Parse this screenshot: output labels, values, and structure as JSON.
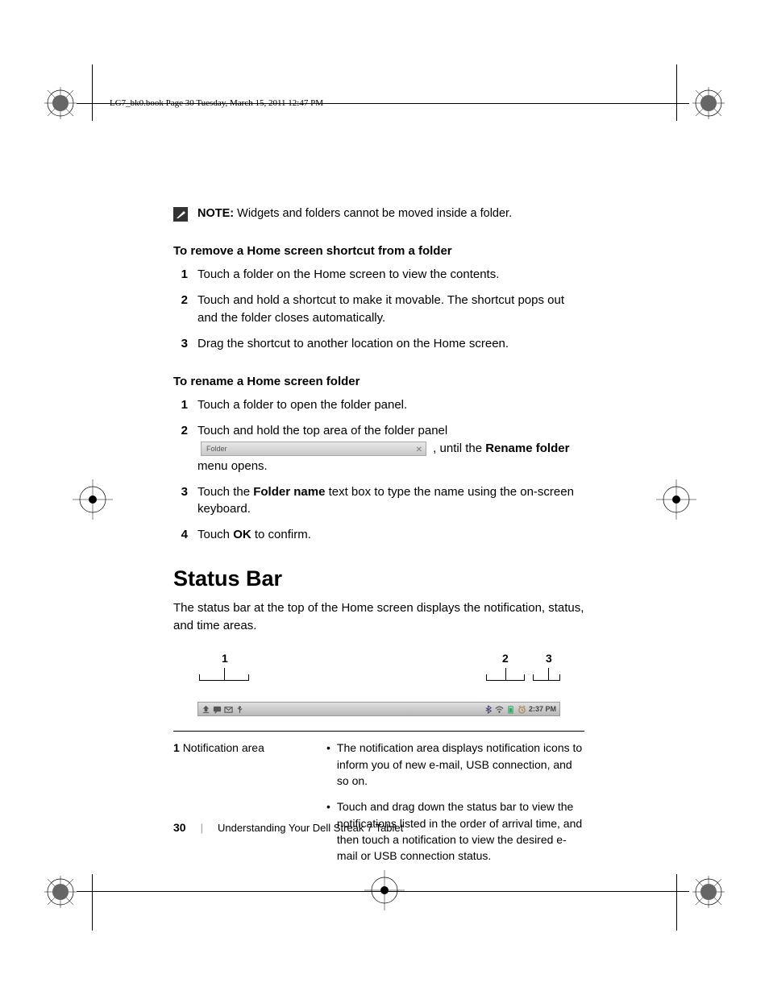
{
  "header": "LG7_bk0.book  Page 30  Tuesday, March 15, 2011  12:47 PM",
  "note": {
    "label": "NOTE:",
    "text": "Widgets and folders cannot be moved inside a folder."
  },
  "section1": {
    "heading": "To remove a Home screen shortcut from a folder",
    "steps": [
      "Touch a folder on the Home screen to view the contents.",
      "Touch and hold a shortcut to make it movable. The shortcut pops out and the folder closes automatically.",
      "Drag the shortcut to another location on the Home screen."
    ]
  },
  "section2": {
    "heading": "To rename a Home screen folder",
    "step1": "Touch a folder to open the folder panel.",
    "step2_a": "Touch and hold the top area of the folder panel ",
    "step2_b": ", until the ",
    "step2_bold1": "Rename folder",
    "step2_c": " menu opens.",
    "folder_label": "Folder",
    "step3_a": "Touch the ",
    "step3_bold": "Folder name",
    "step3_b": " text box to type the name using the on-screen keyboard.",
    "step4_a": "Touch ",
    "step4_bold": "OK",
    "step4_b": " to confirm."
  },
  "statusbar": {
    "heading": "Status Bar",
    "intro": "The status bar at the top of the Home screen displays the notification, status, and time areas.",
    "labels": {
      "l1": "1",
      "l2": "2",
      "l3": "3"
    },
    "time": "2:37 PM"
  },
  "table": {
    "row1_num": "1",
    "row1_label": "Notification area",
    "row1_bullets": [
      "The notification area displays notification icons to inform you of new e-mail, USB connection, and so on.",
      "Touch and drag down the status bar to view the notifications listed in the order of arrival time, and then touch a notification to view the desired e-mail or USB connection status."
    ]
  },
  "footer": {
    "page": "30",
    "title": "Understanding Your Dell Streak 7 Tablet"
  }
}
